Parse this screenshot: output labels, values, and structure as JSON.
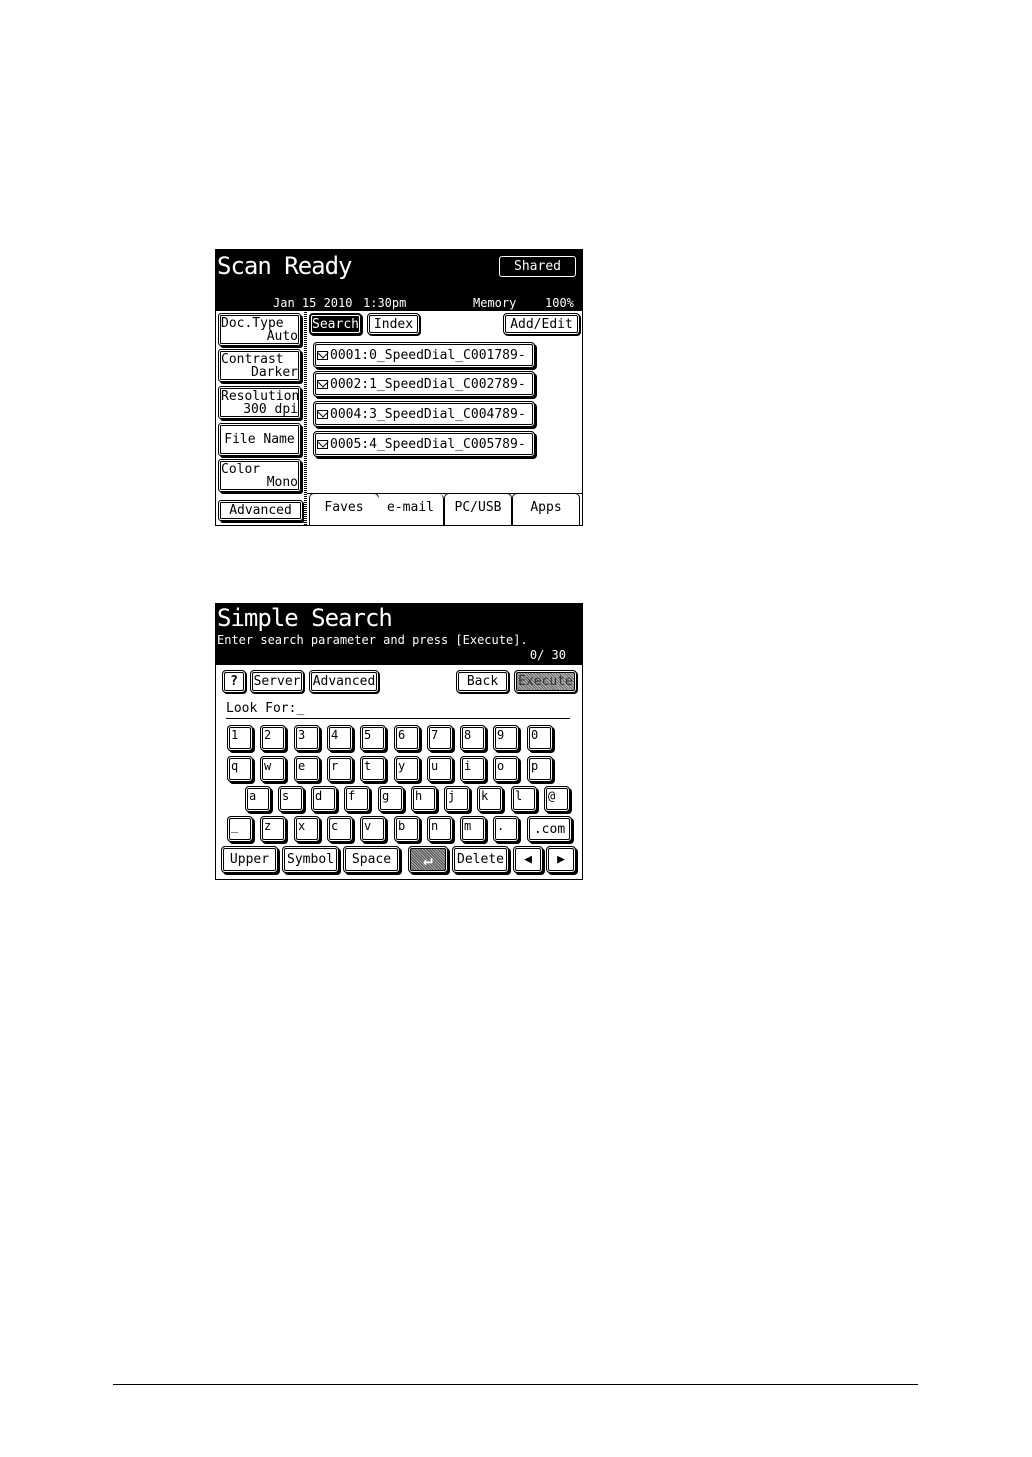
{
  "scan_ready": {
    "title": "Scan Ready",
    "shared_button": "Shared",
    "date": "Jan 15 2010",
    "time": "1:30pm",
    "memory_label": "Memory",
    "memory_value": "100%",
    "side_buttons": [
      {
        "label": "Doc.Type",
        "value": "Auto"
      },
      {
        "label": "Contrast",
        "value": "Darker"
      },
      {
        "label": "Resolution",
        "value": "300 dpi"
      },
      {
        "label": "File Name",
        "value": ""
      },
      {
        "label": "Color",
        "value": "Mono"
      }
    ],
    "advanced_button": "Advanced",
    "toolbar": {
      "search": "Search",
      "index": "Index",
      "add_edit": "Add/Edit"
    },
    "entries": [
      "0001:0_SpeedDial_C001789-",
      "0002:1_SpeedDial_C002789-",
      "0004:3_SpeedDial_C004789-",
      "0005:4_SpeedDial_C005789-"
    ],
    "entry_icon": "mail-icon",
    "tabs": [
      "Faves",
      "e-mail",
      "PC/USB",
      "Apps"
    ],
    "active_tab": "e-mail"
  },
  "simple_search": {
    "title": "Simple Search",
    "message": "Enter search parameter and press [Execute].",
    "counter": "0/ 30",
    "toolbar": {
      "help": "?",
      "server": "Server",
      "advanced": "Advanced",
      "back": "Back",
      "execute": "Execute"
    },
    "look_for_label": "Look For:",
    "look_for_value": "_",
    "keys": {
      "row1": [
        "1",
        "2",
        "3",
        "4",
        "5",
        "6",
        "7",
        "8",
        "9",
        "0"
      ],
      "row2": [
        "q",
        "w",
        "e",
        "r",
        "t",
        "y",
        "u",
        "i",
        "o",
        "p"
      ],
      "row3": [
        "a",
        "s",
        "d",
        "f",
        "g",
        "h",
        "j",
        "k",
        "l",
        "@"
      ],
      "row4": [
        "_",
        "z",
        "x",
        "c",
        "v",
        "b",
        "n",
        "m",
        "."
      ],
      "dotcom": ".com"
    },
    "bottom_keys": {
      "upper": "Upper",
      "symbol": "Symbol",
      "space": "Space",
      "enter": "↵",
      "delete": "Delete",
      "left": "◀",
      "right": "▶"
    }
  }
}
